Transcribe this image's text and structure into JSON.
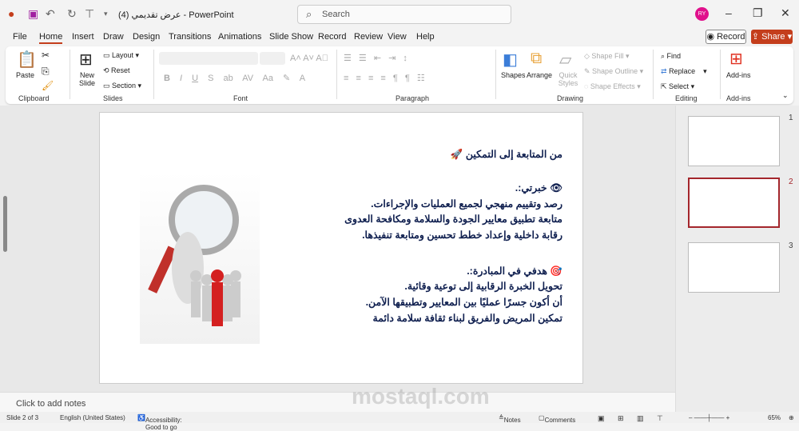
{
  "titlebar": {
    "title": "عرض تقديمي (4)  -  PowerPoint",
    "search_placeholder": "Search",
    "avatar": "RY"
  },
  "tabs": [
    "File",
    "Home",
    "Insert",
    "Draw",
    "Design",
    "Transitions",
    "Animations",
    "Slide Show",
    "Record",
    "Review",
    "View",
    "Help"
  ],
  "record": "Record",
  "share": "Share",
  "ribbon": {
    "clipboard": {
      "label": "Clipboard",
      "paste": "Paste"
    },
    "slides": {
      "label": "Slides",
      "new_slide": "New Slide",
      "layout": "Layout",
      "reset": "Reset",
      "section": "Section"
    },
    "font": {
      "label": "Font",
      "bold": "B",
      "italic": "I",
      "underline": "U",
      "strike": "S"
    },
    "paragraph": {
      "label": "Paragraph"
    },
    "drawing": {
      "label": "Drawing",
      "shapes": "Shapes",
      "arrange": "Arrange",
      "quick_styles": "Quick Styles",
      "shape_fill": "Shape Fill",
      "shape_outline": "Shape Outline",
      "shape_effects": "Shape Effects"
    },
    "editing": {
      "label": "Editing",
      "find": "Find",
      "replace": "Replace",
      "select": "Select"
    },
    "addins": {
      "label": "Add-ins",
      "button": "Add-ins"
    }
  },
  "slide": {
    "title": "من المتابعة إلى التمكين 🚀",
    "h1": "👁 خبرتي:.",
    "l1": "رصد وتقييم منهجي لجميع العمليات والإجراءات.",
    "l2": "متابعة تطبيق معايير الجودة والسلامة ومكافحة العدوى",
    "l3": "رقابة داخلية وإعداد خطط تحسين ومتابعة تنفيذها.",
    "h2": "🎯 هدفي في المبادرة:.",
    "l4": "تحويل الخبرة الرقابية إلى توعية وقائية.",
    "l5": "أن أكون جسرًا عمليًا بين المعايير وتطبيقها الآمن.",
    "l6": "تمكين المريض والفريق لبناء ثقافة سلامة دائمة"
  },
  "notes_placeholder": "Click to add notes",
  "thumbnails": [
    "1",
    "2",
    "3"
  ],
  "status": {
    "slide": "Slide 2 of 3",
    "language": "English (United States)",
    "accessibility": "Accessibility: Good to go",
    "notes": "Notes",
    "comments": "Comments",
    "zoom": "65%"
  },
  "watermark": "mostaql.com"
}
